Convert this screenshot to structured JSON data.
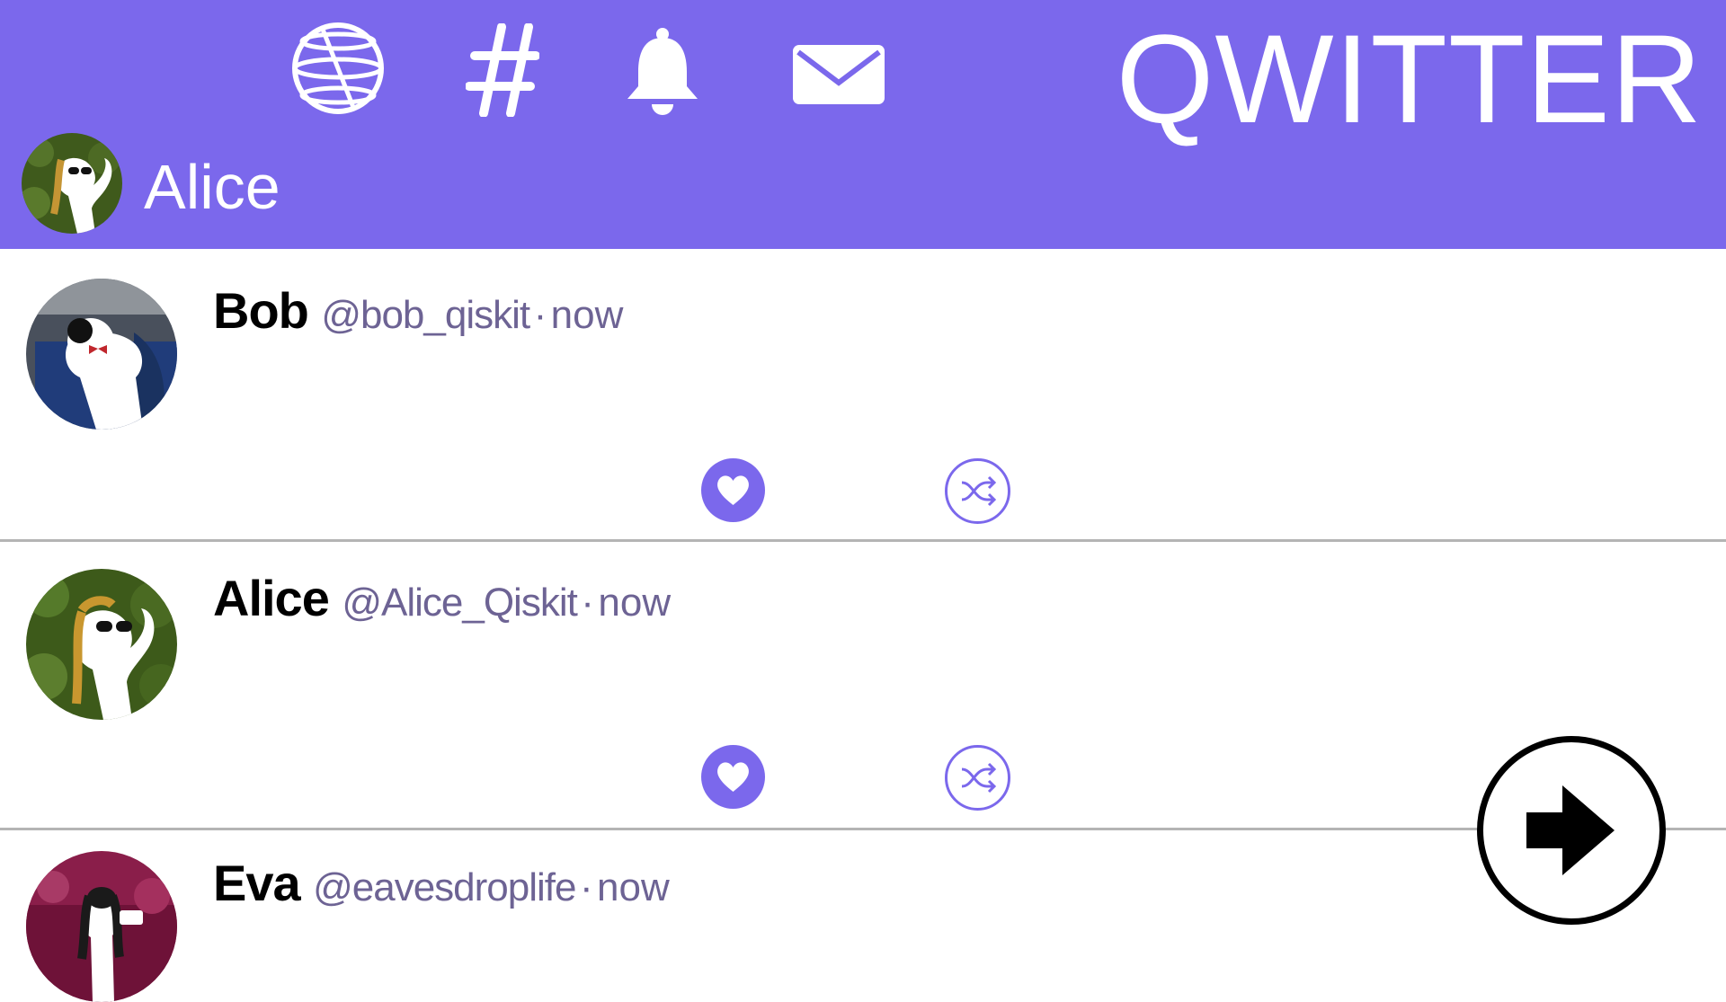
{
  "header": {
    "brand": "QWITTER",
    "current_user": {
      "name": "Alice"
    },
    "nav": [
      {
        "icon": "globe-icon"
      },
      {
        "icon": "hashtag-icon"
      },
      {
        "icon": "bell-icon"
      },
      {
        "icon": "mail-icon"
      }
    ],
    "colors": {
      "accent": "#7b68ec",
      "text_on_accent": "#ffffff"
    }
  },
  "feed": [
    {
      "name": "Bob",
      "handle": "@bob_qiskit",
      "separator": "·",
      "time": "now",
      "actions": [
        "heart-icon",
        "shuffle-icon"
      ]
    },
    {
      "name": "Alice",
      "handle": "@Alice_Qiskit",
      "separator": "·",
      "time": "now",
      "actions": [
        "heart-icon",
        "shuffle-icon"
      ]
    },
    {
      "name": "Eva",
      "handle": "@eavesdroplife",
      "separator": "·",
      "time": "now",
      "actions": []
    }
  ],
  "next_button": {
    "icon": "arrow-right-icon"
  }
}
